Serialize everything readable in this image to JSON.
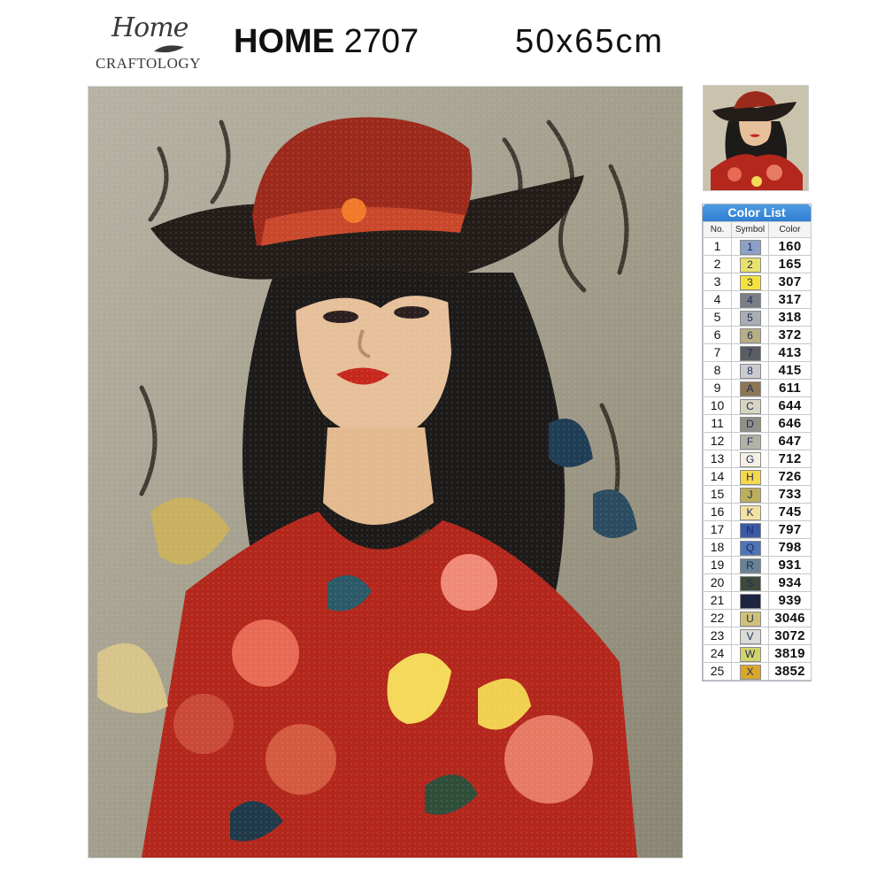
{
  "logo": {
    "script": "Home",
    "sub": "CRAFTOLOGY"
  },
  "product": {
    "code_prefix": "HOME",
    "code_number": "2707",
    "size": "50x65cm"
  },
  "artwork": {
    "subject": "woman in red cowboy hat with flowers",
    "kind": "diamond painting mosaic"
  },
  "color_list": {
    "title": "Color List",
    "headers": {
      "no": "No.",
      "symbol": "Symbol",
      "color": "Color"
    },
    "rows": [
      {
        "no": "1",
        "symbol": "1",
        "color": "160",
        "swatch": "#8da0c8"
      },
      {
        "no": "2",
        "symbol": "2",
        "color": "165",
        "swatch": "#e8e26a"
      },
      {
        "no": "3",
        "symbol": "3",
        "color": "307",
        "swatch": "#f4e23c"
      },
      {
        "no": "4",
        "symbol": "4",
        "color": "317",
        "swatch": "#7a7e86"
      },
      {
        "no": "5",
        "symbol": "5",
        "color": "318",
        "swatch": "#a9adb4"
      },
      {
        "no": "6",
        "symbol": "6",
        "color": "372",
        "swatch": "#b7ae84"
      },
      {
        "no": "7",
        "symbol": "7",
        "color": "413",
        "swatch": "#5a5d62"
      },
      {
        "no": "8",
        "symbol": "8",
        "color": "415",
        "swatch": "#c9cbcf"
      },
      {
        "no": "9",
        "symbol": "A",
        "color": "611",
        "swatch": "#8c7654"
      },
      {
        "no": "10",
        "symbol": "C",
        "color": "644",
        "swatch": "#d8d4c2"
      },
      {
        "no": "11",
        "symbol": "D",
        "color": "646",
        "swatch": "#8e9186"
      },
      {
        "no": "12",
        "symbol": "F",
        "color": "647",
        "swatch": "#b2b3a6"
      },
      {
        "no": "13",
        "symbol": "G",
        "color": "712",
        "swatch": "#f5f0e3"
      },
      {
        "no": "14",
        "symbol": "H",
        "color": "726",
        "swatch": "#f6d84c"
      },
      {
        "no": "15",
        "symbol": "J",
        "color": "733",
        "swatch": "#bcae5a"
      },
      {
        "no": "16",
        "symbol": "K",
        "color": "745",
        "swatch": "#f3e3a0"
      },
      {
        "no": "17",
        "symbol": "N",
        "color": "797",
        "swatch": "#3a5aa8"
      },
      {
        "no": "18",
        "symbol": "Q",
        "color": "798",
        "swatch": "#4e74b8"
      },
      {
        "no": "19",
        "symbol": "R",
        "color": "931",
        "swatch": "#6a8296"
      },
      {
        "no": "20",
        "symbol": "S",
        "color": "934",
        "swatch": "#3e4a3a"
      },
      {
        "no": "21",
        "symbol": "T",
        "color": "939",
        "swatch": "#1e2340"
      },
      {
        "no": "22",
        "symbol": "U",
        "color": "3046",
        "swatch": "#cfc07a"
      },
      {
        "no": "23",
        "symbol": "V",
        "color": "3072",
        "swatch": "#d9dcd6"
      },
      {
        "no": "24",
        "symbol": "W",
        "color": "3819",
        "swatch": "#d2d36a"
      },
      {
        "no": "25",
        "symbol": "X",
        "color": "3852",
        "swatch": "#d9a82a"
      }
    ]
  },
  "colors": {
    "header_blue": "#3a8ad8",
    "background": "#ffffff"
  }
}
